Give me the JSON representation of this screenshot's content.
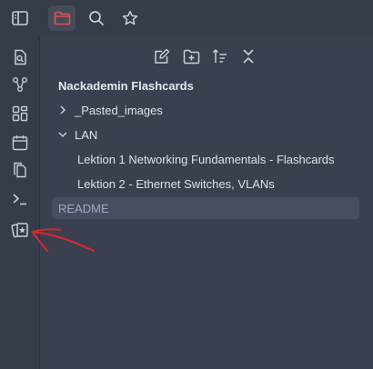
{
  "topbar": {
    "icons": [
      "sidebar-toggle-icon",
      "folder-icon",
      "search-icon",
      "star-icon"
    ],
    "active": "folder-icon"
  },
  "ribbon": {
    "icons": [
      "open-quick-switcher-icon",
      "graph-icon",
      "canvas-icon",
      "calendar-icon",
      "copy-icon",
      "terminal-icon",
      "flashcards-icon"
    ]
  },
  "nav_buttons": [
    "new-note-icon",
    "new-folder-icon",
    "sort-icon",
    "collapse-icon"
  ],
  "file_tree": {
    "vault_name": "Nackademin Flashcards",
    "items": [
      {
        "label": "_Pasted_images",
        "type": "folder",
        "expanded": false
      },
      {
        "label": "LAN",
        "type": "folder",
        "expanded": true
      },
      {
        "label": "Lektion 1 Networking Fundamentals - Flashcards",
        "type": "file"
      },
      {
        "label": "Lektion 2 - Ethernet Switches, VLANs",
        "type": "file"
      },
      {
        "label": "README",
        "type": "file",
        "selected": true
      }
    ]
  },
  "colors": {
    "accent": "#e0524f",
    "annotation": "#d2292f",
    "background": "#363c4a",
    "panel": "#3a4050"
  }
}
